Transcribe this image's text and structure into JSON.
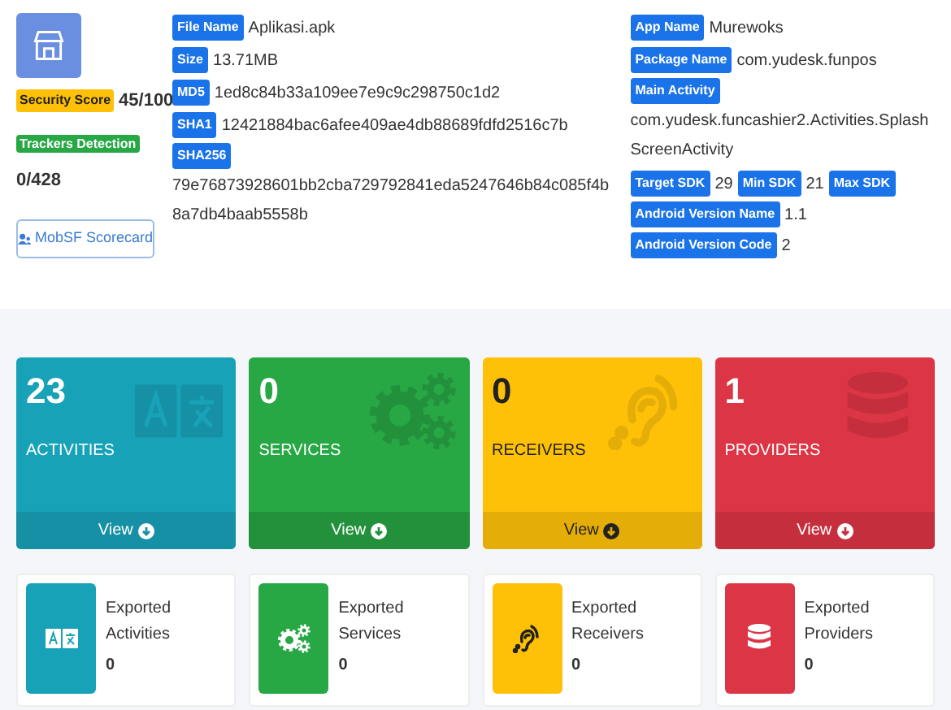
{
  "app": {
    "security_score_label": "Security Score",
    "security_score": "45/100",
    "trackers_label": "Trackers Detection",
    "trackers": "0/428",
    "scorecard_button": "MobSF Scorecard"
  },
  "file_info": [
    {
      "kind": "inline",
      "fields": [
        {
          "label": "File Name",
          "value": "Aplikasi.apk"
        }
      ]
    },
    {
      "kind": "inline",
      "fields": [
        {
          "label": "Size",
          "value": "13.71MB"
        }
      ]
    },
    {
      "kind": "inline",
      "fields": [
        {
          "label": "MD5",
          "value": "1ed8c84b33a109ee7e9c9c298750c1d2"
        }
      ]
    },
    {
      "kind": "inline",
      "fields": [
        {
          "label": "SHA1",
          "value": "12421884bac6afee409ae4db88689fdfd2516c7b"
        }
      ]
    },
    {
      "kind": "block",
      "fields": [
        {
          "label": "SHA256",
          "value": "79e76873928601bb2cba729792841eda5247646b84c085f4b8a7db4baab5558b"
        }
      ]
    }
  ],
  "app_info": [
    {
      "kind": "inline",
      "fields": [
        {
          "label": "App Name",
          "value": "Murewoks"
        }
      ]
    },
    {
      "kind": "inline",
      "fields": [
        {
          "label": "Package Name",
          "value": "com.yudesk.funpos"
        }
      ]
    },
    {
      "kind": "block",
      "fields": [
        {
          "label": "Main Activity",
          "value": "com.yudesk.funcashier2.Activities.SplashScreenActivity"
        }
      ]
    },
    {
      "kind": "inline",
      "fields": [
        {
          "label": "Target SDK",
          "value": "29"
        },
        {
          "label": "Min SDK",
          "value": "21"
        },
        {
          "label": "Max SDK"
        }
      ]
    },
    {
      "kind": "inline",
      "fields": [
        {
          "label": "Android Version Name",
          "value": "1.1"
        },
        {
          "label": "Android Version Code",
          "value": "2"
        }
      ]
    }
  ],
  "cards": [
    {
      "kind": "activities",
      "count": "23",
      "title": "ACTIVITIES",
      "button": "View",
      "color": "#17a2b8"
    },
    {
      "kind": "services",
      "count": "0",
      "title": "SERVICES",
      "button": "View",
      "color": "#28a745"
    },
    {
      "kind": "receivers",
      "count": "0",
      "title": "RECEIVERS",
      "button": "View",
      "color": "#ffc107"
    },
    {
      "kind": "providers",
      "count": "1",
      "title": "PROVIDERS",
      "button": "View",
      "color": "#dc3545"
    }
  ],
  "exported": [
    {
      "kind": "activities",
      "label": "Exported Activities",
      "count": "0",
      "color": "#17a2b8"
    },
    {
      "kind": "services",
      "label": "Exported Services",
      "count": "0",
      "color": "#28a745"
    },
    {
      "kind": "receivers",
      "label": "Exported Receivers",
      "count": "0",
      "color": "#ffc107"
    },
    {
      "kind": "providers",
      "label": "Exported Providers",
      "count": "0",
      "color": "#dc3545"
    }
  ]
}
